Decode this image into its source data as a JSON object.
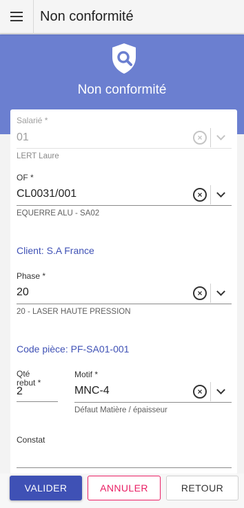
{
  "app_bar": {
    "title": "Non conformité"
  },
  "hero": {
    "title": "Non conformité",
    "icon": "shield-search-icon"
  },
  "form": {
    "salarie": {
      "label": "Salarié *",
      "value": "01",
      "hint": "LERT Laure"
    },
    "of": {
      "label": "OF *",
      "value": "CL0031/001",
      "hint": "EQUERRE ALU - SA02"
    },
    "client": "Client: S.A France",
    "phase": {
      "label": "Phase *",
      "value": "20",
      "hint": "20 - LASER HAUTE PRESSION"
    },
    "code_piece": "Code pièce: PF-SA01-001",
    "qte_rebut": {
      "label_line1": "Qté",
      "label_line2": "rebut *",
      "value": "2"
    },
    "motif": {
      "label": "Motif *",
      "value": "MNC-4",
      "hint": "Défaut Matière / épaisseur"
    },
    "constat": {
      "label": "Constat",
      "value": ""
    }
  },
  "actions": {
    "valider": "VALIDER",
    "annuler": "ANNULER",
    "retour": "RETOUR"
  },
  "colors": {
    "primary": "#3f51b5",
    "hero": "#6b7fd0",
    "cancel": "#e91e63"
  }
}
